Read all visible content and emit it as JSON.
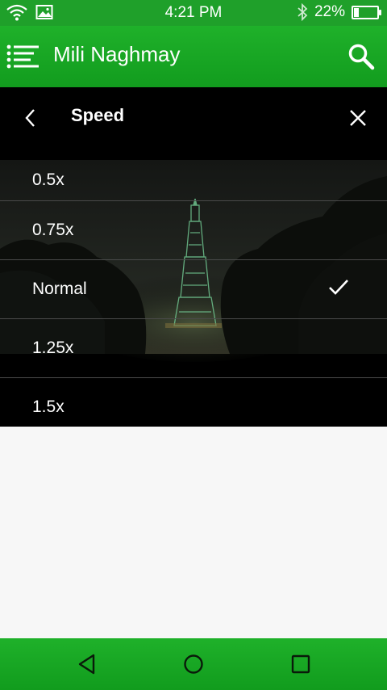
{
  "status_bar": {
    "time": "4:21 PM",
    "battery": "22%",
    "battery_level": 0.22,
    "icons": [
      "wifi-icon",
      "image-icon",
      "bluetooth-icon",
      "battery-icon"
    ]
  },
  "app_bar": {
    "title": "Mili Naghmay",
    "menu_icon": "menu-list-icon",
    "search_icon": "search-icon"
  },
  "speed_panel": {
    "title": "Speed",
    "back_icon": "chevron-left-icon",
    "close_icon": "close-icon",
    "options": [
      {
        "label": "0.5x",
        "selected": false
      },
      {
        "label": "0.75x",
        "selected": false
      },
      {
        "label": "Normal",
        "selected": true
      },
      {
        "label": "1.25x",
        "selected": false
      },
      {
        "label": "1.5x",
        "selected": false
      }
    ]
  },
  "nav_bar": {
    "icons": [
      "back-triangle-icon",
      "home-circle-icon",
      "recents-square-icon"
    ]
  },
  "colors": {
    "brand_green": "#1fa02a",
    "panel_black": "#000000",
    "page_background": "#f7f7f7"
  }
}
